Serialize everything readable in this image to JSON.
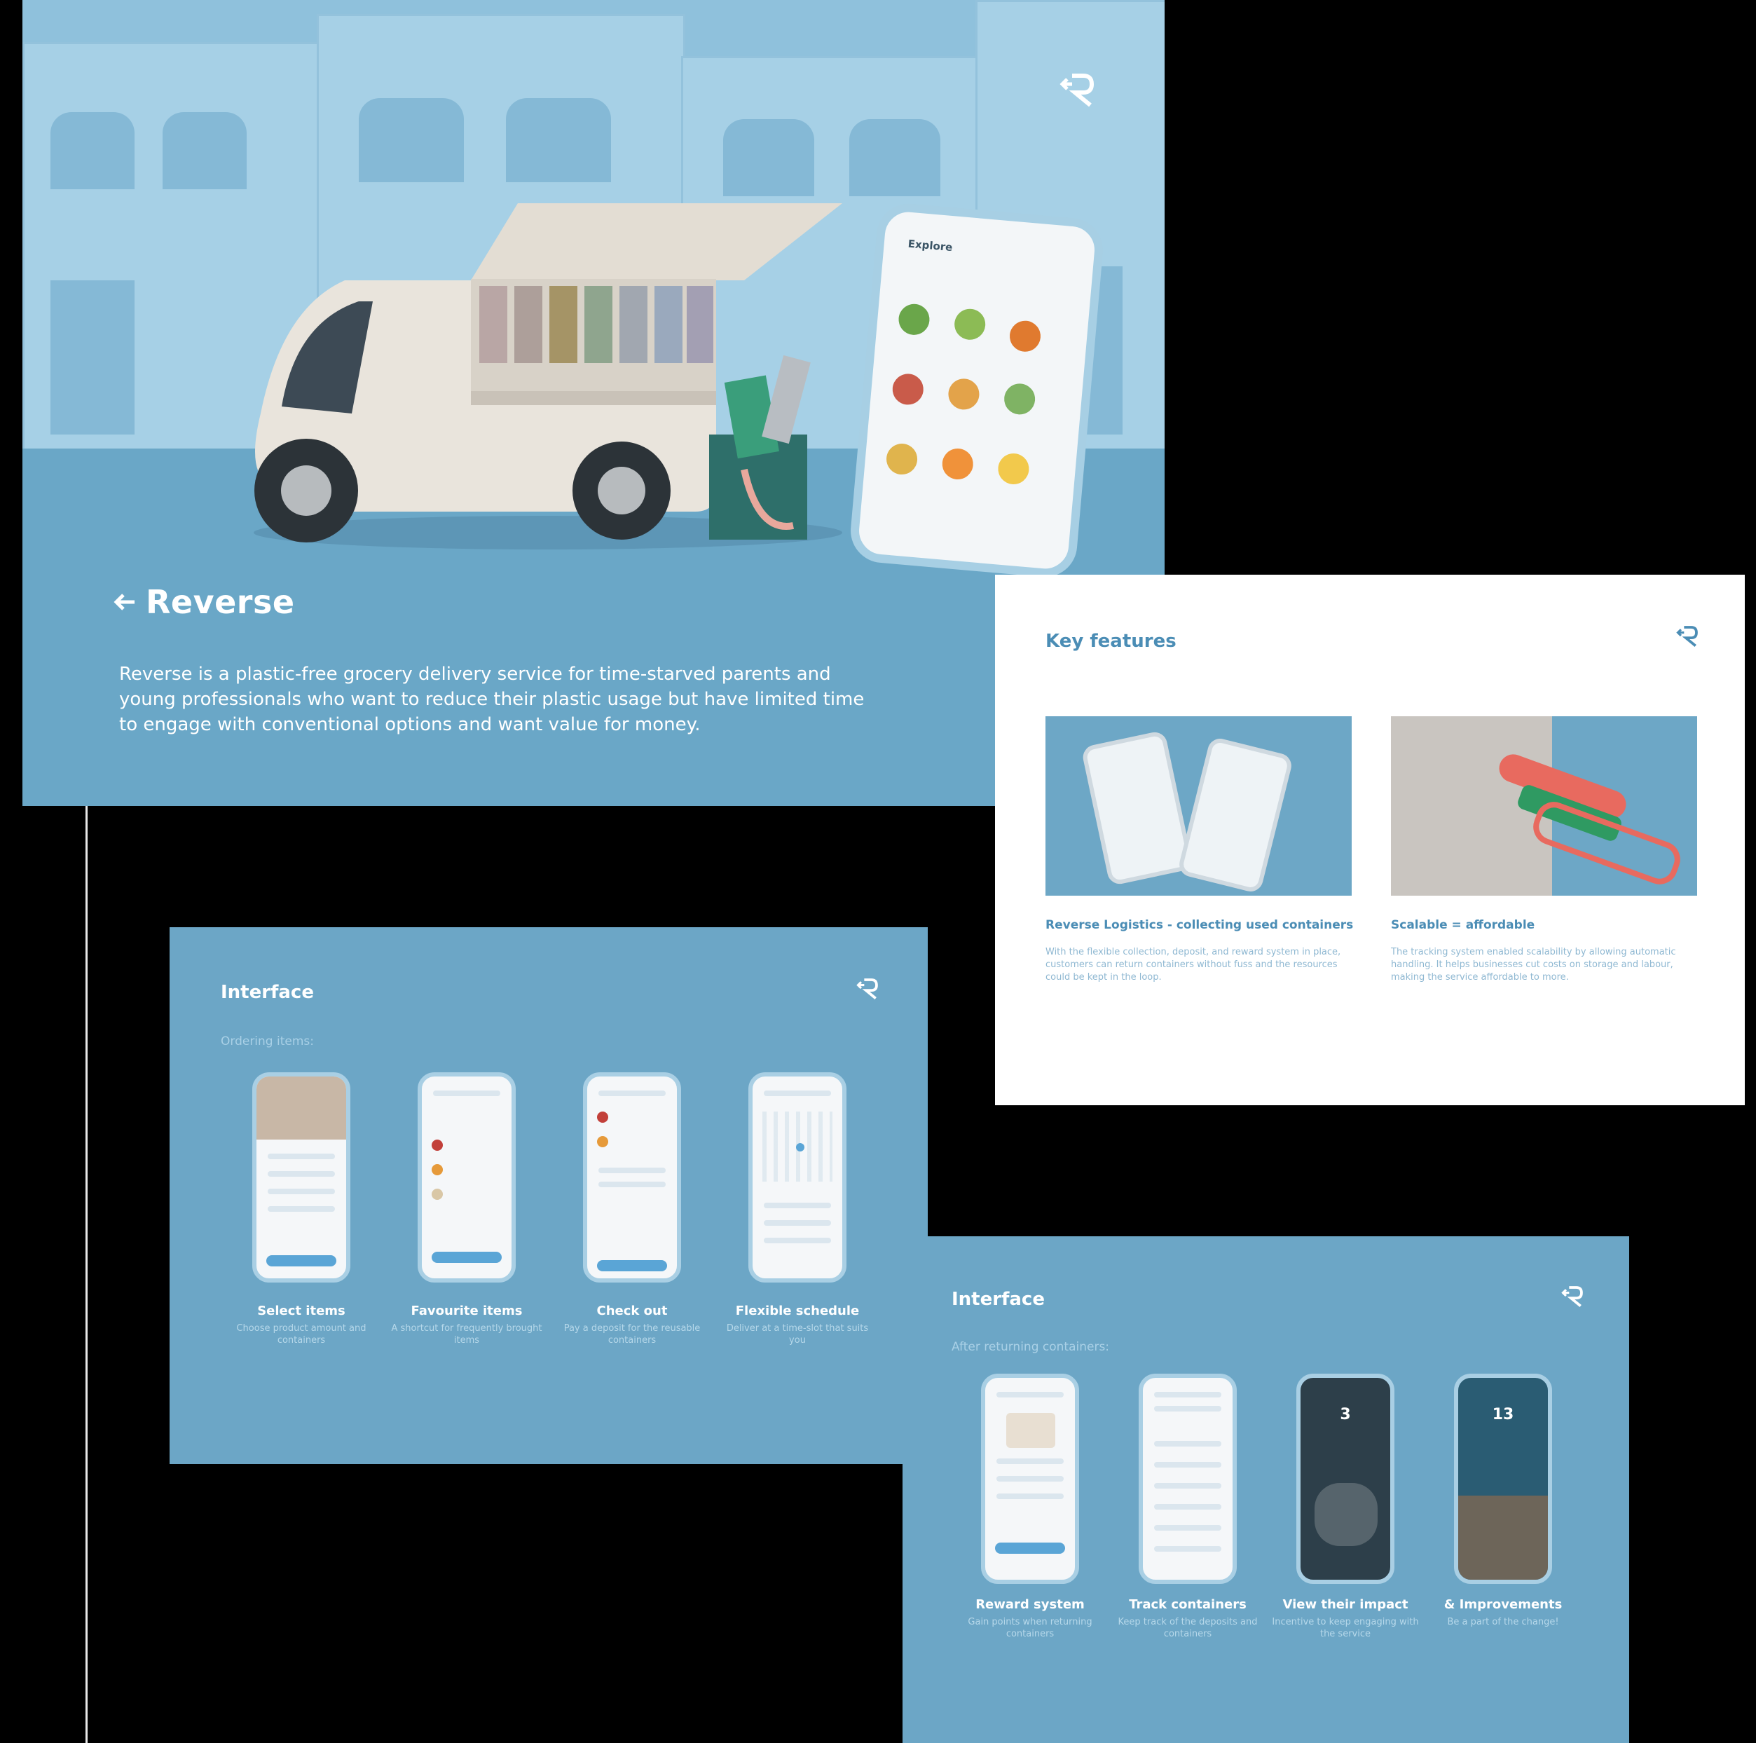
{
  "hero": {
    "brand": "Reverse",
    "description": "Reverse is a plastic-free grocery delivery service for time-starved parents and young professionals who want to reduce their plastic usage but have limited time to engage with conventional options and want value for money.",
    "phone_title": "Explore"
  },
  "key_features": {
    "title": "Key features",
    "features": [
      {
        "title": "Reverse Logistics - collecting used containers",
        "text": "With the flexible collection, deposit, and reward system in place, customers can return containers without fuss and the resources could be kept in the loop."
      },
      {
        "title": "Scalable = affordable",
        "text": "The tracking system enabled scalability by allowing automatic handling. It helps businesses cut costs on storage and labour, making the service affordable to more."
      }
    ]
  },
  "interface_ordering": {
    "title": "Interface",
    "subtitle": "Ordering items:",
    "screens": [
      {
        "title": "Select items",
        "text": "Choose product amount and containers"
      },
      {
        "title": "Favourite items",
        "text": "A shortcut for frequently brought items"
      },
      {
        "title": "Check out",
        "text": "Pay a deposit for the reusable containers"
      },
      {
        "title": "Flexible schedule",
        "text": "Deliver at a time-slot that suits you"
      }
    ]
  },
  "interface_returning": {
    "title": "Interface",
    "subtitle": "After returning containers:",
    "screens": [
      {
        "title": "Reward system",
        "text": "Gain points when returning containers"
      },
      {
        "title": "Track containers",
        "text": "Keep track of the deposits and containers"
      },
      {
        "title": "View their impact",
        "text": "Incentive to keep engaging with the service",
        "number": "3"
      },
      {
        "title": "& Improvements",
        "text": "Be a part of the change!",
        "number": "13"
      }
    ]
  },
  "colors": {
    "slide_blue": "#6ca6c6",
    "accent": "#4b8db5"
  }
}
